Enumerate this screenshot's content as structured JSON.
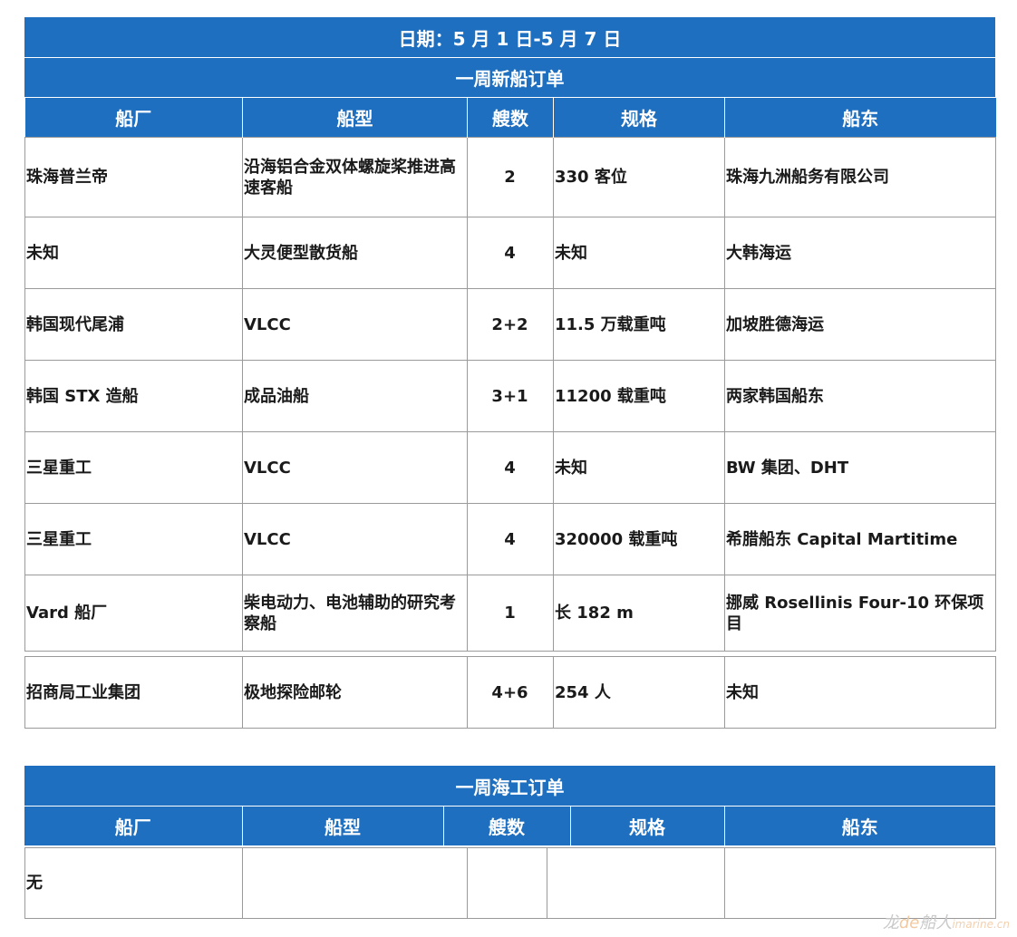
{
  "date_banner": "日期：5 月 1 日-5 月 7 日",
  "new_ship": {
    "title": "一周新船订单",
    "headers": [
      "船厂",
      "船型",
      "艘数",
      "规格",
      "船东"
    ],
    "rows": [
      {
        "yard": "珠海普兰帝",
        "type": "沿海铝合金双体螺旋桨推进高速客船",
        "count": "2",
        "spec": "330 客位",
        "owner": "珠海九洲船务有限公司"
      },
      {
        "yard": "未知",
        "type": "大灵便型散货船",
        "count": "4",
        "spec": "未知",
        "owner": "大韩海运"
      },
      {
        "yard": "韩国现代尾浦",
        "type": "VLCC",
        "count": "2+2",
        "spec": "11.5 万载重吨",
        "owner": "加坡胜德海运"
      },
      {
        "yard": "韩国 STX 造船",
        "type": "成品油船",
        "count": "3+1",
        "spec": "11200 载重吨",
        "owner": "两家韩国船东"
      },
      {
        "yard": "三星重工",
        "type": "VLCC",
        "count": "4",
        "spec": "未知",
        "owner": "BW 集团、DHT"
      },
      {
        "yard": "三星重工",
        "type": "VLCC",
        "count": "4",
        "spec": "320000 载重吨",
        "owner": "希腊船东 Capital Martitime"
      },
      {
        "yard": "Vard 船厂",
        "type": "柴电动力、电池辅助的研究考察船",
        "count": "1",
        "spec": "长 182 m",
        "owner": "挪威 Rosellinis Four-10 环保项目"
      },
      {
        "yard": "招商局工业集团",
        "type": "极地探险邮轮",
        "count": "4+6",
        "spec": "254 人",
        "owner": "未知"
      }
    ]
  },
  "offshore": {
    "title": "一周海工订单",
    "headers": [
      "船厂",
      "船型",
      "艘数",
      "规格",
      "船东"
    ],
    "rows": [
      {
        "yard": "无",
        "type": "",
        "count": "",
        "spec": "",
        "owner": ""
      }
    ]
  },
  "watermark": {
    "a": "龙",
    "b": "de",
    "c": "船人",
    "d": "imarine.cn"
  }
}
